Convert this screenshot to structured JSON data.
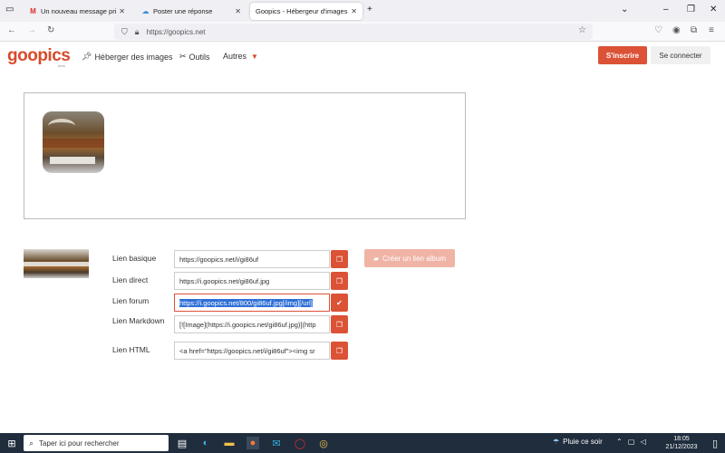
{
  "browser": {
    "tabs": [
      {
        "label": "Un nouveau message privé vient",
        "icon": "gmail-icon"
      },
      {
        "label": "Poster une réponse",
        "icon": "forum-icon"
      },
      {
        "label": "Goopics - Hébergeur d'images et d",
        "icon": "goopics-icon"
      }
    ],
    "url": "https://goopics.net"
  },
  "site": {
    "logo": "goopics",
    "logo_sub": "beta",
    "menu": {
      "host": "Héberger des images",
      "tools": "Outils",
      "others": "Autres"
    },
    "signup": "S'inscrire",
    "login": "Se connecter"
  },
  "links": {
    "basic_label": "Lien basique",
    "basic_value": "https://goopics.net/i/gi86uf",
    "direct_label": "Lien direct",
    "direct_value": "https://i.goopics.net/gi86uf.jpg",
    "forum_label": "Lien forum",
    "forum_value": "https://i.goopics.net/800/gi86uf.jpg[/img][/url]",
    "markdown_label": "Lien Markdown",
    "markdown_value": "[![Image](https://i.goopics.net/gi86uf.jpg)](http",
    "html_label": "Lien HTML",
    "html_value": "<a href=\"https://goopics.net/i/gi86uf\"><img sr",
    "album_button": "Créer un lien album"
  },
  "taskbar": {
    "search": "Taper ici pour rechercher",
    "weather": "Pluie ce soir",
    "time": "18:05",
    "date": "21/12/2023"
  },
  "colors": {
    "accent": "#db5236",
    "accent_light": "#f0b4a6",
    "taskbar": "#1f2d3d"
  }
}
